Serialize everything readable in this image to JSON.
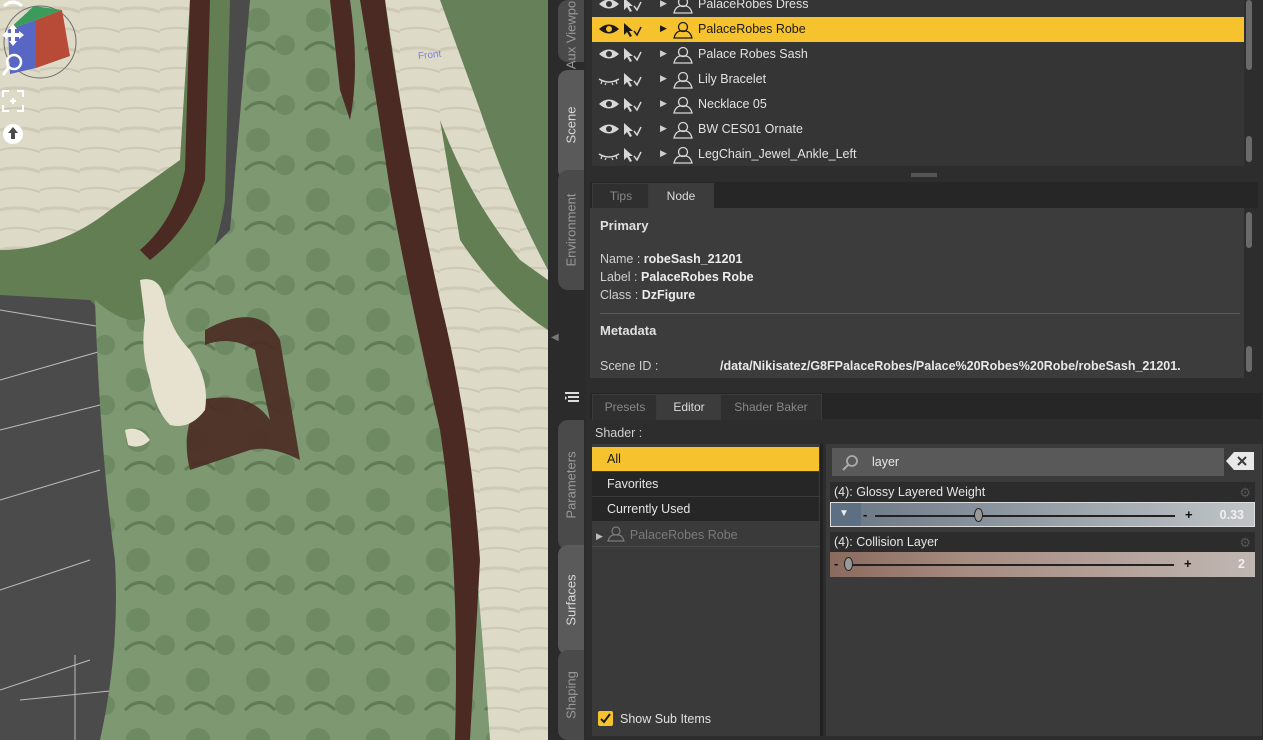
{
  "viewport": {
    "cube_label": "Front",
    "tools": [
      "rotate-orbit-icon",
      "pan-icon",
      "zoom-icon",
      "frame-icon",
      "reset-icon"
    ]
  },
  "side_tabs": [
    {
      "label": "Aux Viewport",
      "active": false
    },
    {
      "label": "Scene",
      "active": true
    },
    {
      "label": "Environment",
      "active": false
    },
    {
      "label": "Parameters",
      "active": false
    },
    {
      "label": "Surfaces",
      "active": true
    },
    {
      "label": "Shaping",
      "active": false
    }
  ],
  "scene": {
    "rows": [
      {
        "name": "PalaceRobes Dress",
        "visible": true,
        "selected": false
      },
      {
        "name": "PalaceRobes Robe",
        "visible": true,
        "selected": true
      },
      {
        "name": "Palace Robes Sash",
        "visible": true,
        "selected": false
      },
      {
        "name": "Lily Bracelet",
        "visible": false,
        "selected": false
      },
      {
        "name": "Necklace 05",
        "visible": true,
        "selected": false
      },
      {
        "name": "BW CES01 Ornate",
        "visible": true,
        "selected": false
      },
      {
        "name": "LegChain_Jewel_Ankle_Left",
        "visible": false,
        "selected": false
      }
    ]
  },
  "info": {
    "tabs": [
      "Tips",
      "Node"
    ],
    "active_tab": "Node",
    "primary_heading": "Primary",
    "name_label": "Name : ",
    "name_value": "robeSash_21201",
    "label_label": "Label : ",
    "label_value": "PalaceRobes Robe",
    "class_label": "Class : ",
    "class_value": "DzFigure",
    "metadata_heading": "Metadata",
    "scene_id_label": "Scene ID :",
    "scene_id_value": "/data/Nikisatez/G8FPalaceRobes/Palace%20Robes%20Robe/robeSash_21201."
  },
  "surfaces": {
    "tabs": [
      "Presets",
      "Editor",
      "Shader Baker"
    ],
    "active_tab": "Editor",
    "shader_label": "Shader :",
    "categories": [
      "All",
      "Favorites",
      "Currently Used"
    ],
    "selected_category": "All",
    "tree_item": "PalaceRobes Robe",
    "show_sub_items": "Show Sub Items",
    "search_value": "layer",
    "properties": [
      {
        "title": "(4): Glossy Layered Weight",
        "value": "0.33",
        "fraction": 0.33,
        "color": "#5d6f83"
      },
      {
        "title": "(4): Collision Layer",
        "value": "2",
        "fraction": 0.0,
        "color": "#8a6a5d"
      }
    ]
  },
  "colors": {
    "selection": "#f6c22d",
    "panel_bg": "#3c3c3c",
    "robe_green": "#627e52",
    "robe_trim": "#4a2a22"
  }
}
